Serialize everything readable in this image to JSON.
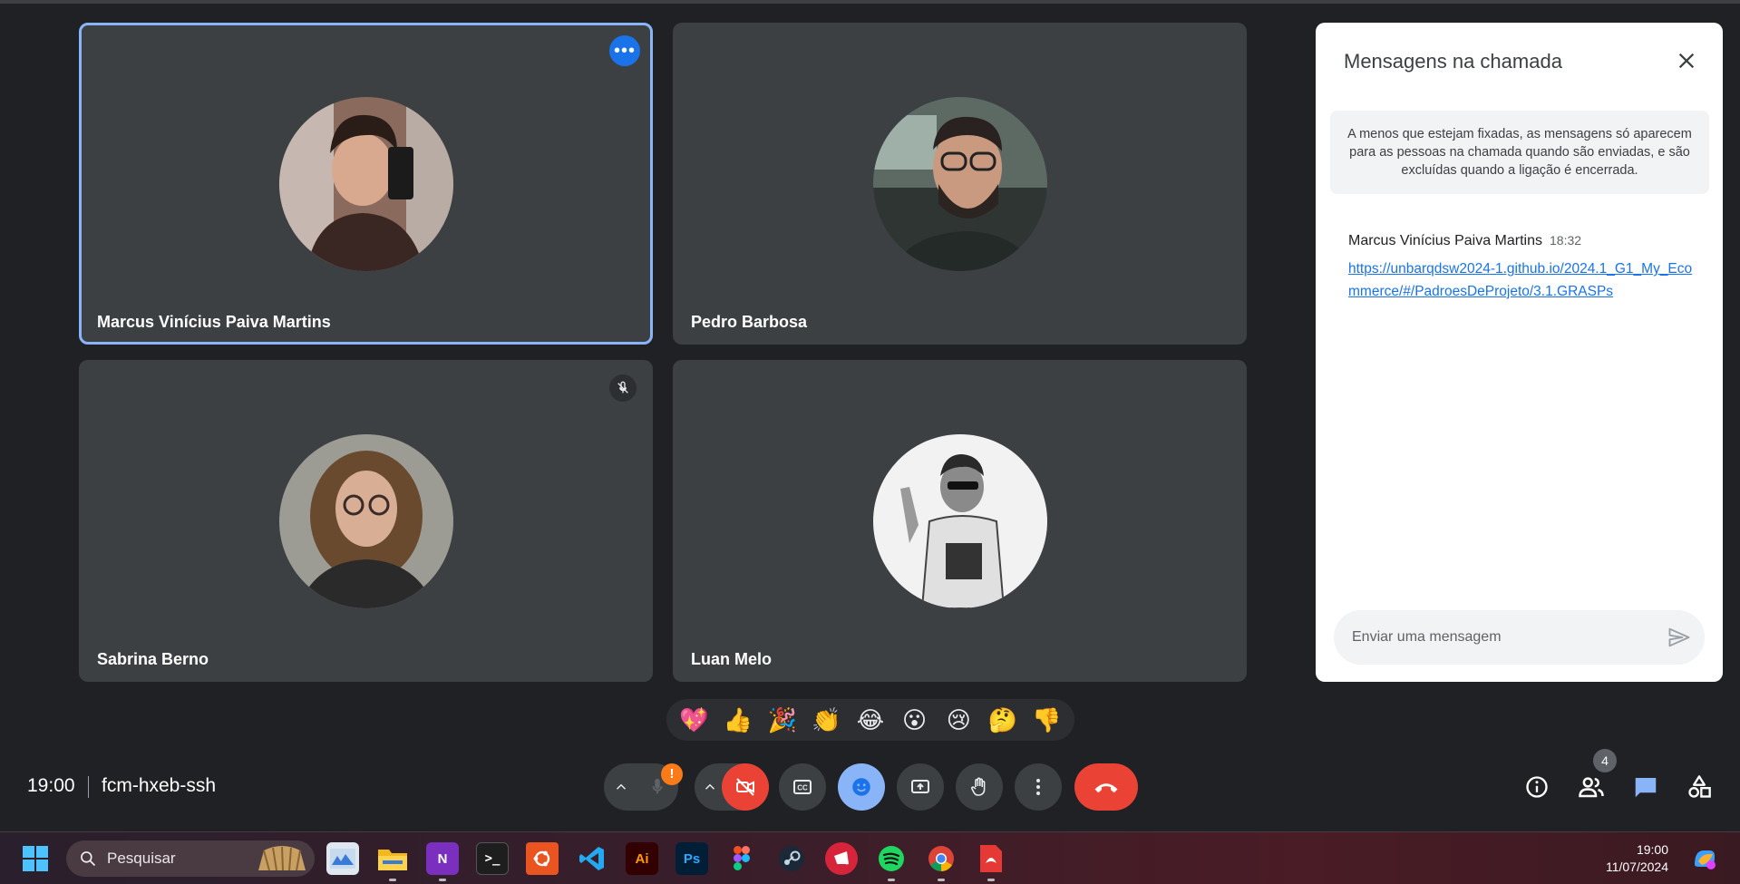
{
  "participants": [
    {
      "name": "Marcus Vinícius Paiva Martins",
      "active": true,
      "icon": "more-options-icon"
    },
    {
      "name": "Pedro Barbosa",
      "active": false
    },
    {
      "name": "Sabrina Berno",
      "active": false,
      "icon": "mic-off-icon"
    },
    {
      "name": "Luan Melo",
      "active": false
    }
  ],
  "chat": {
    "title": "Mensagens na chamada",
    "info": "A menos que estejam fixadas, as mensagens só aparecem para as pessoas na chamada quando são enviadas, e são excluídas quando a ligação é encerrada.",
    "messages": [
      {
        "sender": "Marcus Vinícius Paiva Martins",
        "time": "18:32",
        "link": "https://unbarqdsw2024-1.github.io/2024.1_G1_My_Ecommerce/#/PadroesDeProjeto/3.1.GRASPs"
      }
    ],
    "input_placeholder": "Enviar uma mensagem"
  },
  "reactions": [
    "💖",
    "👍",
    "🎉",
    "👏",
    "😂",
    "😮",
    "😢",
    "🤔",
    "👎"
  ],
  "meeting": {
    "time": "19:00",
    "code": "fcm-hxeb-ssh",
    "mic_warning": "!",
    "people_count": "4"
  },
  "taskbar": {
    "search_label": "Pesquisar",
    "clock_time": "19:00",
    "clock_date": "11/07/2024",
    "apps": [
      "Ai",
      "Ps"
    ]
  },
  "colors": {
    "accent": "#8ab4f8",
    "end_call": "#ea4335",
    "background": "#202124",
    "tile": "#3c4043"
  }
}
